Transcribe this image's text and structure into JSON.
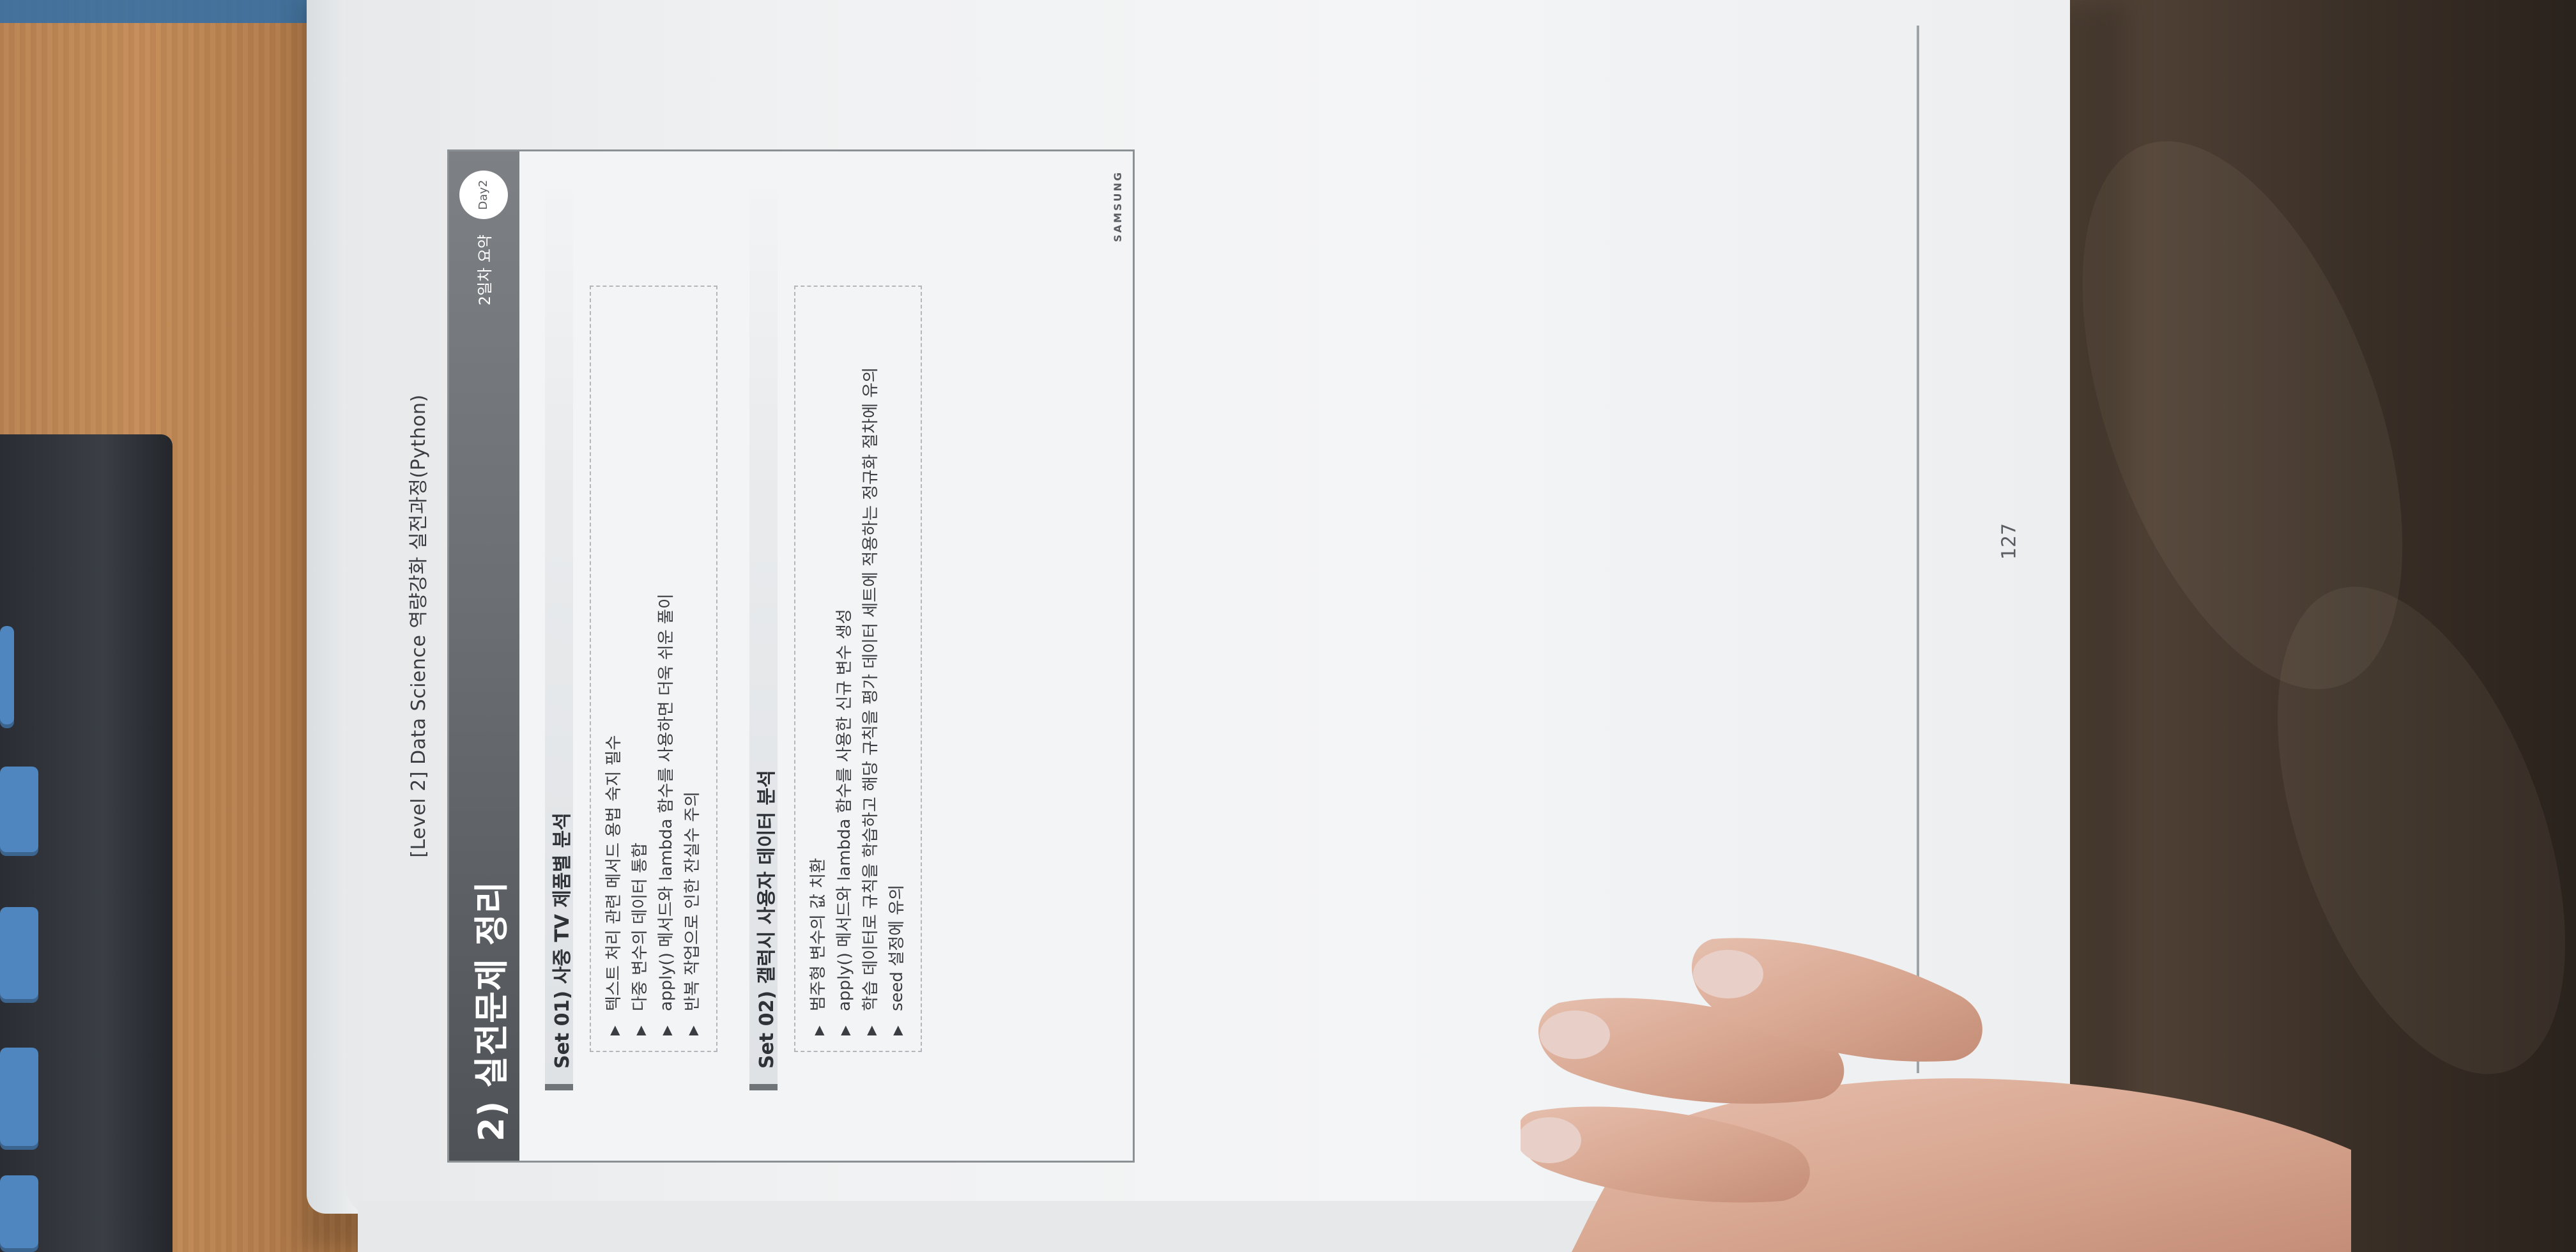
{
  "book": {
    "running_head": "[Level 2] Data Science 역량강화 실전과정(Python)",
    "page_number": "127"
  },
  "slide": {
    "title": "2) 실전문제 정리",
    "tag": "2일차 요약",
    "badge": "Day2",
    "brand": "SAMSUNG",
    "sets": [
      {
        "title": "Set 01) 사중 TV 제품별 분석",
        "bullets": [
          "텍스트 처리 관련 메서드 용법 숙지 필수",
          "다중 변수의 데이터 통합",
          "apply() 메서드와 lambda 함수를 사용하면 더욱 쉬운 풀이",
          "반복 작업으로 인한 잔실수 주의"
        ]
      },
      {
        "title": "Set 02) 갤럭시 사용자 데이터 분석",
        "bullets": [
          "범주형 변수의 값 치환",
          "apply() 메서드와 lambda 함수를 사용한 신규 변수 생성",
          "학습 데이터로 규칙을 학습하고 해당 규칙을 평가 데이터 세트에 적용하는 정규화 절차에 유의",
          "seed 설정에 유의"
        ]
      }
    ],
    "bullet_glyph": "▶"
  },
  "colors": {
    "banner": "#5f6367",
    "page": "#f2f3f4",
    "desk": "#b98252"
  }
}
